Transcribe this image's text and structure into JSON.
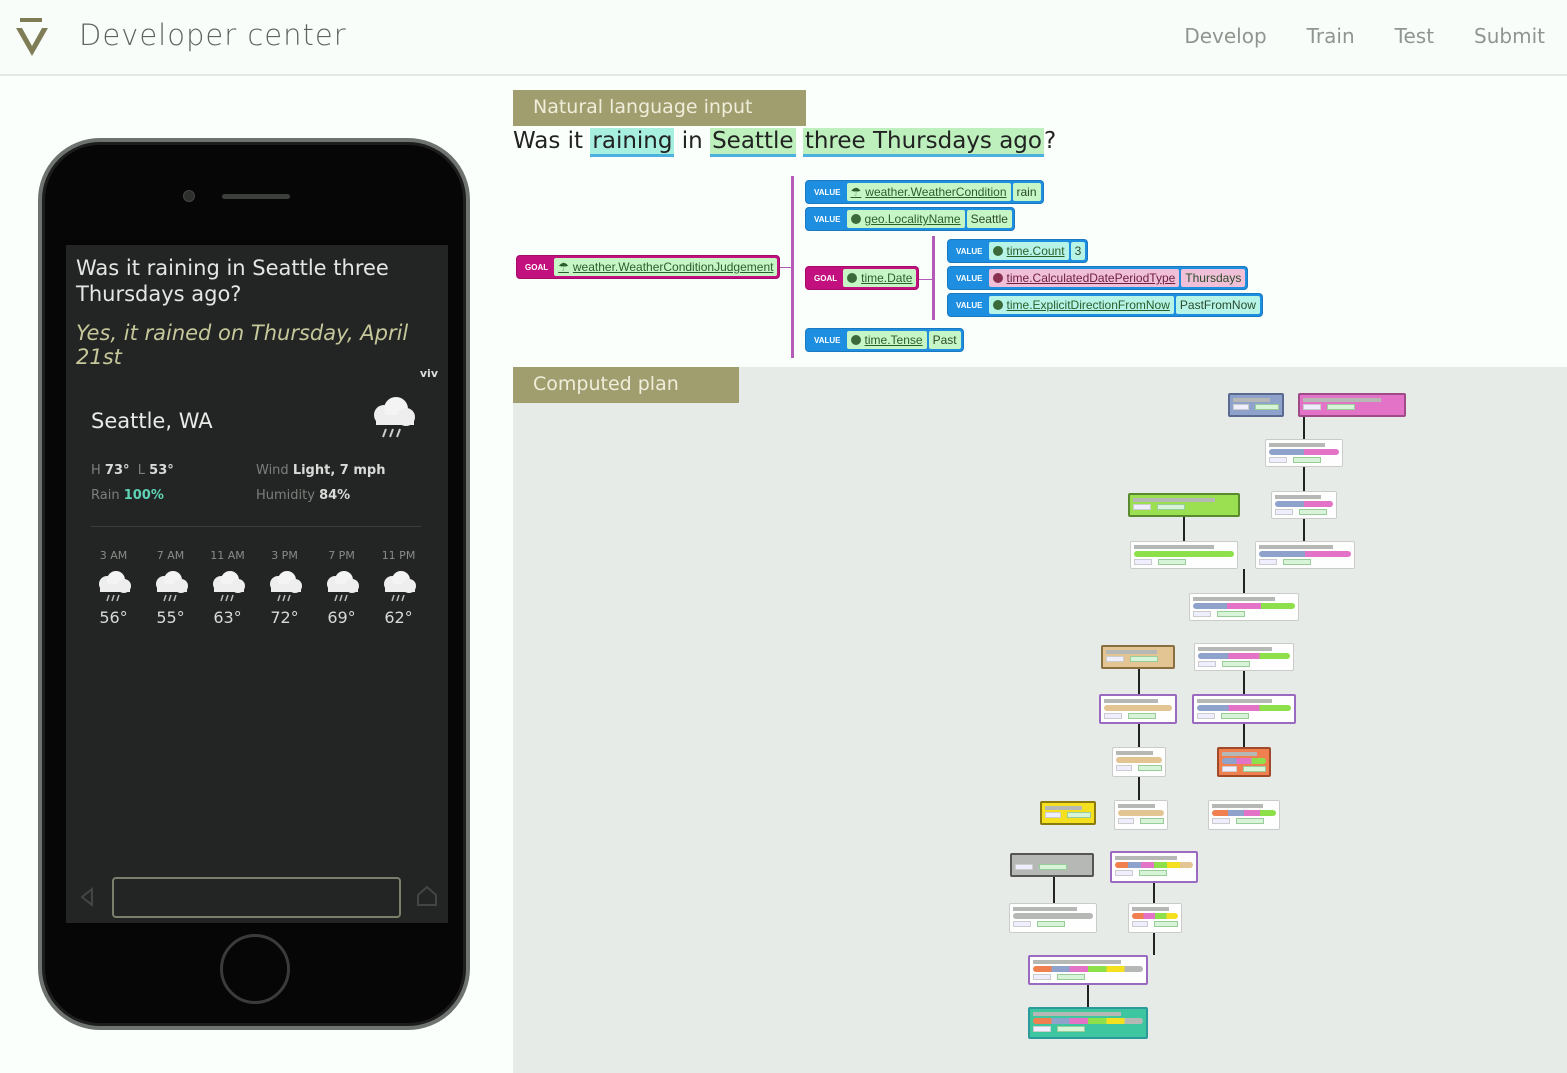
{
  "header": {
    "title": "Developer center",
    "nav": [
      "Develop",
      "Train",
      "Test",
      "Submit"
    ]
  },
  "phone": {
    "question": "Was it raining in Seattle three Thursdays ago?",
    "answer": "Yes, it rained on Thursday, April 21st",
    "brand_mark": "viv",
    "city": "Seattle, WA",
    "high_label": "H",
    "high": "73°",
    "low_label": "L",
    "low": "53°",
    "rain_label": "Rain",
    "rain": "100%",
    "wind_label": "Wind",
    "wind": "Light, 7 mph",
    "humidity_label": "Humidity",
    "humidity": "84%",
    "hourly": [
      {
        "time": "3 AM",
        "temp": "56°",
        "icon": "rain-cloud-icon"
      },
      {
        "time": "7 AM",
        "temp": "55°",
        "icon": "rain-cloud-icon"
      },
      {
        "time": "11 AM",
        "temp": "63°",
        "icon": "rain-cloud-icon"
      },
      {
        "time": "3 PM",
        "temp": "72°",
        "icon": "rain-cloud-icon"
      },
      {
        "time": "7 PM",
        "temp": "69°",
        "icon": "rain-cloud-icon"
      },
      {
        "time": "11 PM",
        "temp": "62°",
        "icon": "rain-cloud-icon"
      }
    ],
    "input_value": ""
  },
  "nl_input": {
    "label": "Natural language input",
    "tokens": [
      {
        "text": "Was it ",
        "hl": ""
      },
      {
        "text": "raining",
        "hl": "a"
      },
      {
        "text": " in ",
        "hl": ""
      },
      {
        "text": "Seattle",
        "hl": "b"
      },
      {
        "text": " ",
        "hl": ""
      },
      {
        "text": "three Thursdays ago",
        "hl": "b"
      },
      {
        "text": "?",
        "hl": ""
      }
    ]
  },
  "parse_tree": {
    "root": {
      "kind": "GOAL",
      "type": "weather.WeatherConditionJudgement"
    },
    "values": [
      {
        "kind": "VALUE",
        "type": "weather.WeatherCondition",
        "value": "rain"
      },
      {
        "kind": "VALUE",
        "type": "geo.LocalityName",
        "value": "Seattle"
      },
      {
        "kind": "VALUE",
        "type": "time.Tense",
        "value": "Past"
      }
    ],
    "date_goal": {
      "kind": "GOAL",
      "type": "time.Date"
    },
    "date_values": [
      {
        "kind": "VALUE",
        "type": "time.Count",
        "value": "3"
      },
      {
        "kind": "VALUE",
        "type": "time.CalculatedDatePeriodType",
        "value": "Thursdays"
      },
      {
        "kind": "VALUE",
        "type": "time.ExplicitDirectionFromNow",
        "value": "PastFromNow"
      }
    ]
  },
  "plan": {
    "label": "Computed plan"
  }
}
